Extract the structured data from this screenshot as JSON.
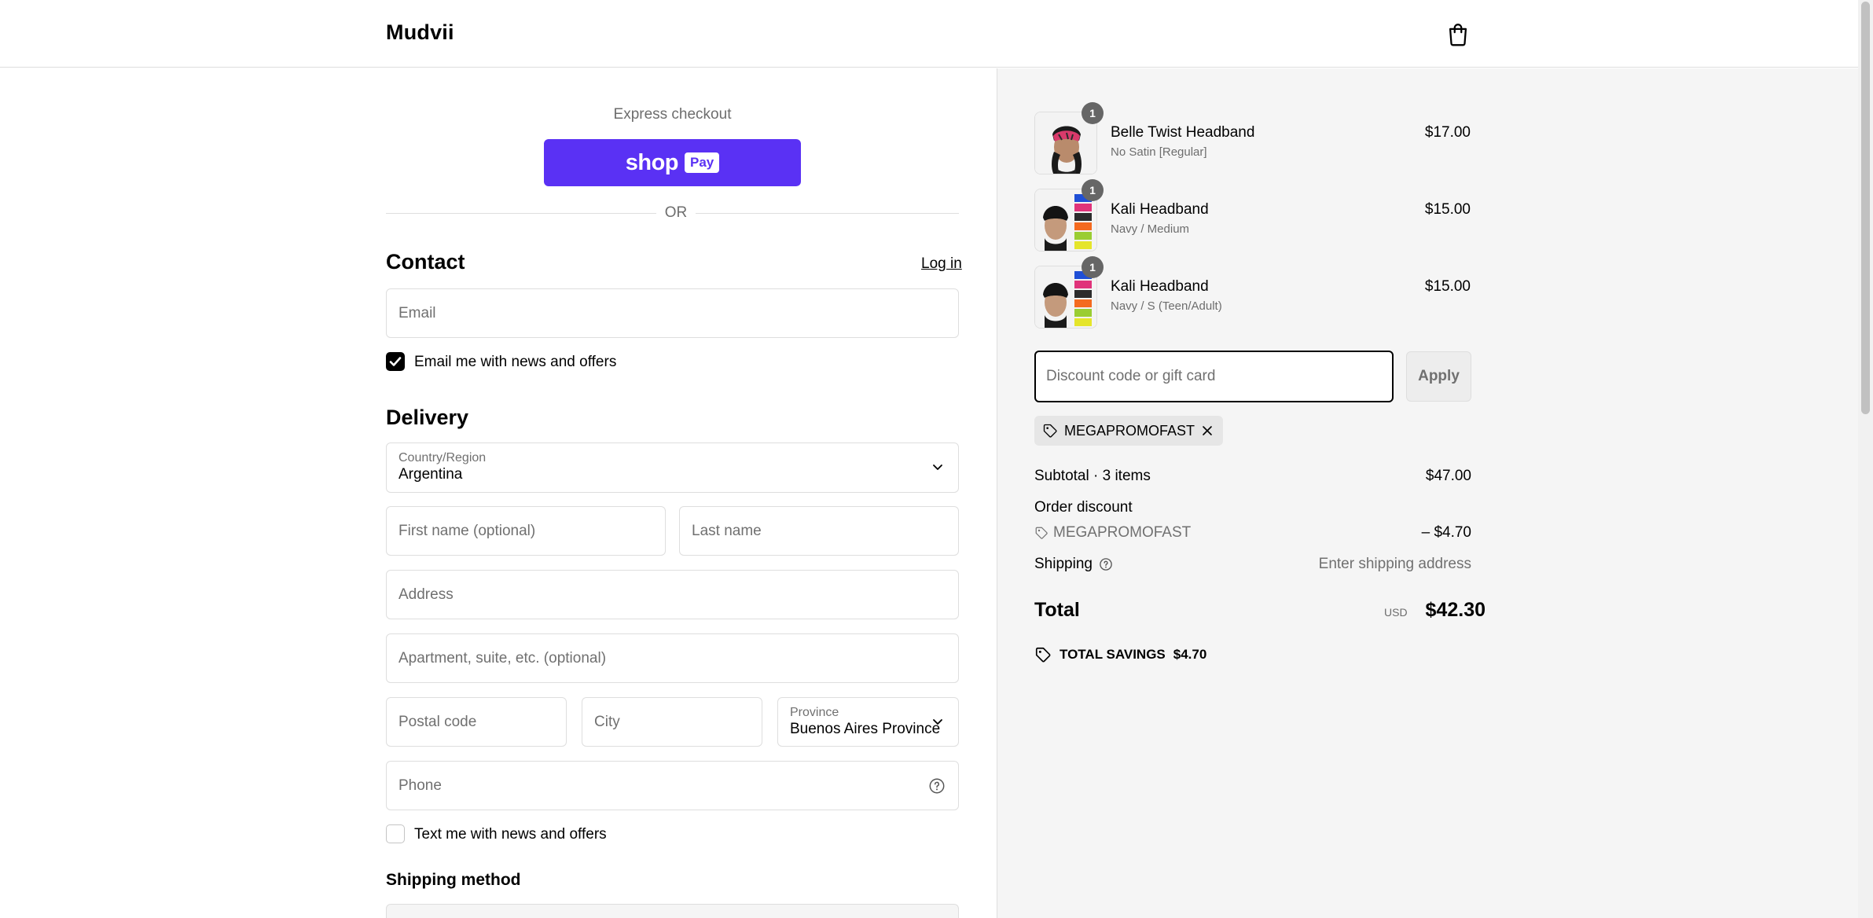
{
  "header": {
    "brand": "Mudvii",
    "cart_icon": "shopping-bag-icon"
  },
  "express": {
    "label": "Express checkout",
    "shop_text": "shop",
    "pay_text": "Pay",
    "or_text": "OR"
  },
  "contact": {
    "heading": "Contact",
    "login_label": "Log in",
    "email_placeholder": "Email",
    "news_checkbox_label": "Email me with news and offers",
    "news_checked": true
  },
  "delivery": {
    "heading": "Delivery",
    "country_label": "Country/Region",
    "country_value": "Argentina",
    "first_name_placeholder": "First name (optional)",
    "last_name_placeholder": "Last name",
    "address_placeholder": "Address",
    "apartment_placeholder": "Apartment, suite, etc. (optional)",
    "postal_placeholder": "Postal code",
    "city_placeholder": "City",
    "province_label": "Province",
    "province_value": "Buenos Aires Province",
    "phone_placeholder": "Phone",
    "text_checkbox_label": "Text me with news and offers",
    "text_checked": false
  },
  "shipping_method": {
    "heading": "Shipping method"
  },
  "order": {
    "items": [
      {
        "name": "Belle Twist Headband",
        "variant": "No Satin [Regular]",
        "price": "$17.00",
        "qty": "1"
      },
      {
        "name": "Kali Headband",
        "variant": "Navy / Medium",
        "price": "$15.00",
        "qty": "1"
      },
      {
        "name": "Kali Headband",
        "variant": "Navy / S (Teen/Adult)",
        "price": "$15.00",
        "qty": "1"
      }
    ],
    "discount_placeholder": "Discount code or gift card",
    "apply_label": "Apply",
    "applied_code": "MEGAPROMOFAST",
    "subtotal_label": "Subtotal · 3 items",
    "subtotal_value": "$47.00",
    "order_discount_label": "Order discount",
    "discount_code": "MEGAPROMOFAST",
    "discount_value": "– $4.70",
    "shipping_label": "Shipping",
    "shipping_value": "Enter shipping address",
    "total_label": "Total",
    "currency": "USD",
    "total_value": "$42.30",
    "savings_label": "TOTAL SAVINGS",
    "savings_value": "$4.70"
  },
  "colors": {
    "shop_pay": "#5a31f4",
    "sidebar_bg": "#f5f5f5",
    "border": "#dedede"
  }
}
